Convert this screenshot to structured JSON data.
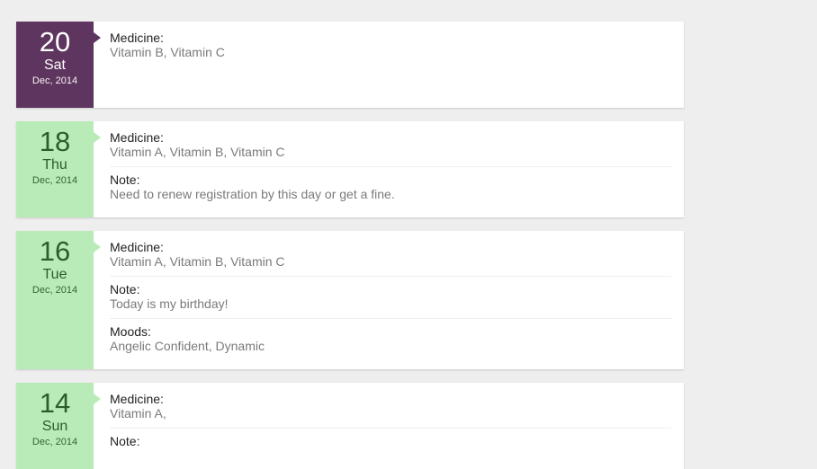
{
  "entries": [
    {
      "color": "purple",
      "date": {
        "day": "20",
        "weekday": "Sat",
        "month_year": "Dec, 2014"
      },
      "sections": [
        {
          "label": "Medicine:",
          "value": "Vitamin B, Vitamin C"
        }
      ]
    },
    {
      "color": "green",
      "date": {
        "day": "18",
        "weekday": "Thu",
        "month_year": "Dec, 2014"
      },
      "sections": [
        {
          "label": "Medicine:",
          "value": "Vitamin A, Vitamin B, Vitamin C"
        },
        {
          "label": "Note:",
          "value": "Need to renew registration by this day or get a fine."
        }
      ]
    },
    {
      "color": "green",
      "date": {
        "day": "16",
        "weekday": "Tue",
        "month_year": "Dec, 2014"
      },
      "sections": [
        {
          "label": "Medicine:",
          "value": "Vitamin A, Vitamin B, Vitamin C"
        },
        {
          "label": "Note:",
          "value": "Today is my birthday!"
        },
        {
          "label": "Moods:",
          "value": "Angelic Confident, Dynamic"
        }
      ]
    },
    {
      "color": "green",
      "date": {
        "day": "14",
        "weekday": "Sun",
        "month_year": "Dec, 2014"
      },
      "sections": [
        {
          "label": "Medicine:",
          "value": "Vitamin A,"
        },
        {
          "label": "Note:",
          "value": ""
        }
      ]
    }
  ]
}
